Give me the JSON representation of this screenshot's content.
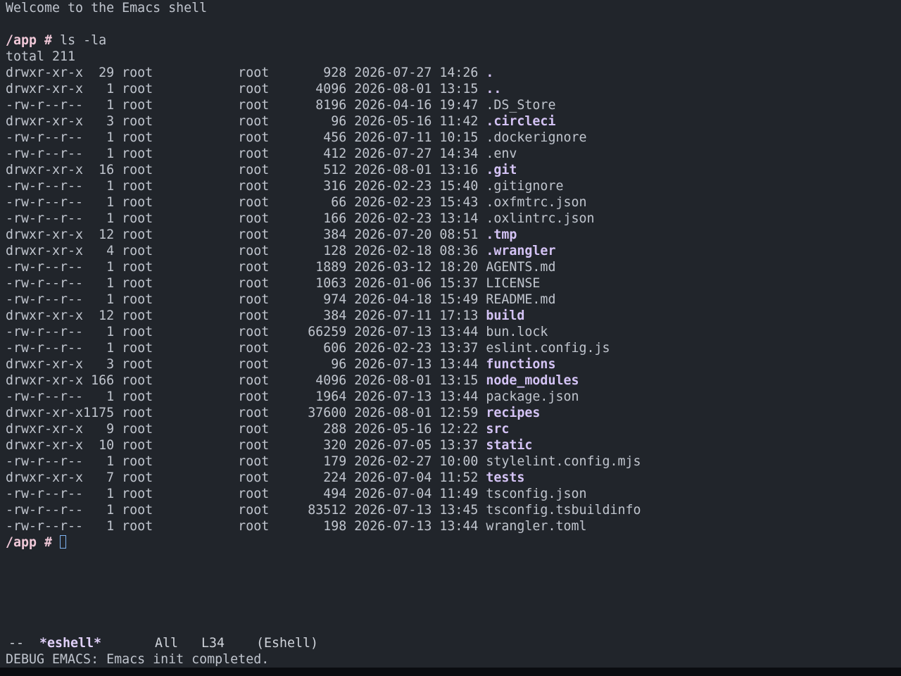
{
  "welcome": "Welcome to the Emacs shell",
  "prompt": "/app #",
  "command": "ls -la",
  "total": "total 211",
  "listing": [
    {
      "perms": "drwxr-xr-x",
      "links": "29",
      "owner": "root",
      "group": "root",
      "size": "928",
      "date": "2026-07-27 14:26",
      "name": ".",
      "is_dir": true
    },
    {
      "perms": "drwxr-xr-x",
      "links": "1",
      "owner": "root",
      "group": "root",
      "size": "4096",
      "date": "2026-08-01 13:15",
      "name": "..",
      "is_dir": true
    },
    {
      "perms": "-rw-r--r--",
      "links": "1",
      "owner": "root",
      "group": "root",
      "size": "8196",
      "date": "2026-04-16 19:47",
      "name": ".DS_Store",
      "is_dir": false
    },
    {
      "perms": "drwxr-xr-x",
      "links": "3",
      "owner": "root",
      "group": "root",
      "size": "96",
      "date": "2026-05-16 11:42",
      "name": ".circleci",
      "is_dir": true
    },
    {
      "perms": "-rw-r--r--",
      "links": "1",
      "owner": "root",
      "group": "root",
      "size": "456",
      "date": "2026-07-11 10:15",
      "name": ".dockerignore",
      "is_dir": false
    },
    {
      "perms": "-rw-r--r--",
      "links": "1",
      "owner": "root",
      "group": "root",
      "size": "412",
      "date": "2026-07-27 14:34",
      "name": ".env",
      "is_dir": false
    },
    {
      "perms": "drwxr-xr-x",
      "links": "16",
      "owner": "root",
      "group": "root",
      "size": "512",
      "date": "2026-08-01 13:16",
      "name": ".git",
      "is_dir": true
    },
    {
      "perms": "-rw-r--r--",
      "links": "1",
      "owner": "root",
      "group": "root",
      "size": "316",
      "date": "2026-02-23 15:40",
      "name": ".gitignore",
      "is_dir": false
    },
    {
      "perms": "-rw-r--r--",
      "links": "1",
      "owner": "root",
      "group": "root",
      "size": "66",
      "date": "2026-02-23 15:43",
      "name": ".oxfmtrc.json",
      "is_dir": false
    },
    {
      "perms": "-rw-r--r--",
      "links": "1",
      "owner": "root",
      "group": "root",
      "size": "166",
      "date": "2026-02-23 13:14",
      "name": ".oxlintrc.json",
      "is_dir": false
    },
    {
      "perms": "drwxr-xr-x",
      "links": "12",
      "owner": "root",
      "group": "root",
      "size": "384",
      "date": "2026-07-20 08:51",
      "name": ".tmp",
      "is_dir": true
    },
    {
      "perms": "drwxr-xr-x",
      "links": "4",
      "owner": "root",
      "group": "root",
      "size": "128",
      "date": "2026-02-18 08:36",
      "name": ".wrangler",
      "is_dir": true
    },
    {
      "perms": "-rw-r--r--",
      "links": "1",
      "owner": "root",
      "group": "root",
      "size": "1889",
      "date": "2026-03-12 18:20",
      "name": "AGENTS.md",
      "is_dir": false
    },
    {
      "perms": "-rw-r--r--",
      "links": "1",
      "owner": "root",
      "group": "root",
      "size": "1063",
      "date": "2026-01-06 15:37",
      "name": "LICENSE",
      "is_dir": false
    },
    {
      "perms": "-rw-r--r--",
      "links": "1",
      "owner": "root",
      "group": "root",
      "size": "974",
      "date": "2026-04-18 15:49",
      "name": "README.md",
      "is_dir": false
    },
    {
      "perms": "drwxr-xr-x",
      "links": "12",
      "owner": "root",
      "group": "root",
      "size": "384",
      "date": "2026-07-11 17:13",
      "name": "build",
      "is_dir": true
    },
    {
      "perms": "-rw-r--r--",
      "links": "1",
      "owner": "root",
      "group": "root",
      "size": "66259",
      "date": "2026-07-13 13:44",
      "name": "bun.lock",
      "is_dir": false
    },
    {
      "perms": "-rw-r--r--",
      "links": "1",
      "owner": "root",
      "group": "root",
      "size": "606",
      "date": "2026-02-23 13:37",
      "name": "eslint.config.js",
      "is_dir": false
    },
    {
      "perms": "drwxr-xr-x",
      "links": "3",
      "owner": "root",
      "group": "root",
      "size": "96",
      "date": "2026-07-13 13:44",
      "name": "functions",
      "is_dir": true
    },
    {
      "perms": "drwxr-xr-x",
      "links": "166",
      "owner": "root",
      "group": "root",
      "size": "4096",
      "date": "2026-08-01 13:15",
      "name": "node_modules",
      "is_dir": true
    },
    {
      "perms": "-rw-r--r--",
      "links": "1",
      "owner": "root",
      "group": "root",
      "size": "1964",
      "date": "2026-07-13 13:44",
      "name": "package.json",
      "is_dir": false
    },
    {
      "perms": "drwxr-xr-x",
      "links": "1175",
      "owner": "root",
      "group": "root",
      "size": "37600",
      "date": "2026-08-01 12:59",
      "name": "recipes",
      "is_dir": true
    },
    {
      "perms": "drwxr-xr-x",
      "links": "9",
      "owner": "root",
      "group": "root",
      "size": "288",
      "date": "2026-05-16 12:22",
      "name": "src",
      "is_dir": true
    },
    {
      "perms": "drwxr-xr-x",
      "links": "10",
      "owner": "root",
      "group": "root",
      "size": "320",
      "date": "2026-07-05 13:37",
      "name": "static",
      "is_dir": true
    },
    {
      "perms": "-rw-r--r--",
      "links": "1",
      "owner": "root",
      "group": "root",
      "size": "179",
      "date": "2026-02-27 10:00",
      "name": "stylelint.config.mjs",
      "is_dir": false
    },
    {
      "perms": "drwxr-xr-x",
      "links": "7",
      "owner": "root",
      "group": "root",
      "size": "224",
      "date": "2026-07-04 11:52",
      "name": "tests",
      "is_dir": true
    },
    {
      "perms": "-rw-r--r--",
      "links": "1",
      "owner": "root",
      "group": "root",
      "size": "494",
      "date": "2026-07-04 11:49",
      "name": "tsconfig.json",
      "is_dir": false
    },
    {
      "perms": "-rw-r--r--",
      "links": "1",
      "owner": "root",
      "group": "root",
      "size": "83512",
      "date": "2026-07-13 13:45",
      "name": "tsconfig.tsbuildinfo",
      "is_dir": false
    },
    {
      "perms": "-rw-r--r--",
      "links": "1",
      "owner": "root",
      "group": "root",
      "size": "198",
      "date": "2026-07-13 13:44",
      "name": "wrangler.toml",
      "is_dir": false
    }
  ],
  "modeline": {
    "status": "--",
    "buffer_name": "*eshell*",
    "position": "All",
    "line": "L34",
    "mode": "(Eshell)"
  },
  "echo_area": "DEBUG EMACS: Emacs init completed.",
  "colors": {
    "background": "#21252b",
    "prompt": "#f0c8d8",
    "directory": "#d4c3f5",
    "text": "#c0c5ce",
    "cursor": "#7fb3f0"
  }
}
